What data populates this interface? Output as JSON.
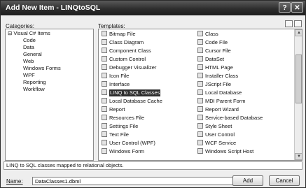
{
  "window": {
    "title": "Add New Item - LINQtoSQL",
    "help_glyph": "?",
    "close_glyph": "✕"
  },
  "categories": {
    "label": "Categories:",
    "root": "Visual C# Items",
    "toggle": "⊟",
    "items": [
      "Code",
      "Data",
      "General",
      "Web",
      "Windows Forms",
      "WPF",
      "Reporting",
      "Workflow"
    ]
  },
  "templates": {
    "label": "Templates:",
    "left_column": [
      {
        "label": "Bitmap File",
        "icon": "bitmap-icon"
      },
      {
        "label": "Class Diagram",
        "icon": "class-diagram-icon"
      },
      {
        "label": "Component Class",
        "icon": "component-icon"
      },
      {
        "label": "Custom Control",
        "icon": "custom-control-icon"
      },
      {
        "label": "Debugger Visualizer",
        "icon": "debugger-icon"
      },
      {
        "label": "Icon File",
        "icon": "icon-file-icon"
      },
      {
        "label": "Interface",
        "icon": "interface-icon"
      },
      {
        "label": "LINQ to SQL Classes",
        "icon": "linq-icon",
        "selected": true
      },
      {
        "label": "Local Database Cache",
        "icon": "database-cache-icon"
      },
      {
        "label": "Report",
        "icon": "report-icon"
      },
      {
        "label": "Resources File",
        "icon": "resources-icon"
      },
      {
        "label": "Settings File",
        "icon": "settings-icon"
      },
      {
        "label": "Text File",
        "icon": "text-file-icon"
      },
      {
        "label": "User Control (WPF)",
        "icon": "user-control-wpf-icon"
      },
      {
        "label": "Windows Form",
        "icon": "windows-form-icon"
      }
    ],
    "right_column": [
      {
        "label": "Class",
        "icon": "class-icon"
      },
      {
        "label": "Code File",
        "icon": "code-file-icon"
      },
      {
        "label": "Cursor File",
        "icon": "cursor-icon"
      },
      {
        "label": "DataSet",
        "icon": "dataset-icon"
      },
      {
        "label": "HTML Page",
        "icon": "html-icon"
      },
      {
        "label": "Installer Class",
        "icon": "installer-icon"
      },
      {
        "label": "JScript File",
        "icon": "jscript-icon"
      },
      {
        "label": "Local Database",
        "icon": "local-database-icon"
      },
      {
        "label": "MDI Parent Form",
        "icon": "mdi-form-icon"
      },
      {
        "label": "Report Wizard",
        "icon": "report-wizard-icon"
      },
      {
        "label": "Service-based Database",
        "icon": "service-db-icon"
      },
      {
        "label": "Style Sheet",
        "icon": "style-sheet-icon"
      },
      {
        "label": "User Control",
        "icon": "user-control-icon"
      },
      {
        "label": "WCF Service",
        "icon": "wcf-icon"
      },
      {
        "label": "Windows Script Host",
        "icon": "script-host-icon"
      }
    ]
  },
  "status": {
    "description": "LINQ to SQL classes mapped to relational objects."
  },
  "name_field": {
    "label": "Name:",
    "value": "DataClasses1.dbml"
  },
  "buttons": {
    "add": "Add",
    "cancel": "Cancel"
  },
  "colors": {
    "title_bar": "#2e2e2e",
    "selection": "#2e2e2e"
  }
}
